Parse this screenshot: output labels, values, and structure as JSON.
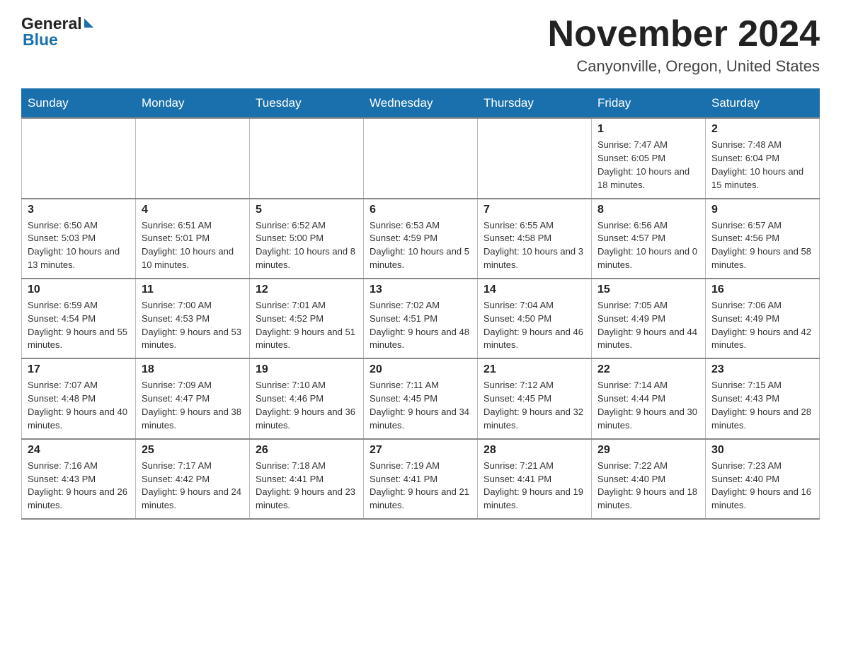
{
  "header": {
    "logo_general": "General",
    "logo_blue": "Blue",
    "month_title": "November 2024",
    "location": "Canyonville, Oregon, United States"
  },
  "calendar": {
    "days_of_week": [
      "Sunday",
      "Monday",
      "Tuesday",
      "Wednesday",
      "Thursday",
      "Friday",
      "Saturday"
    ],
    "weeks": [
      [
        {
          "day": "",
          "info": ""
        },
        {
          "day": "",
          "info": ""
        },
        {
          "day": "",
          "info": ""
        },
        {
          "day": "",
          "info": ""
        },
        {
          "day": "",
          "info": ""
        },
        {
          "day": "1",
          "info": "Sunrise: 7:47 AM\nSunset: 6:05 PM\nDaylight: 10 hours and 18 minutes."
        },
        {
          "day": "2",
          "info": "Sunrise: 7:48 AM\nSunset: 6:04 PM\nDaylight: 10 hours and 15 minutes."
        }
      ],
      [
        {
          "day": "3",
          "info": "Sunrise: 6:50 AM\nSunset: 5:03 PM\nDaylight: 10 hours and 13 minutes."
        },
        {
          "day": "4",
          "info": "Sunrise: 6:51 AM\nSunset: 5:01 PM\nDaylight: 10 hours and 10 minutes."
        },
        {
          "day": "5",
          "info": "Sunrise: 6:52 AM\nSunset: 5:00 PM\nDaylight: 10 hours and 8 minutes."
        },
        {
          "day": "6",
          "info": "Sunrise: 6:53 AM\nSunset: 4:59 PM\nDaylight: 10 hours and 5 minutes."
        },
        {
          "day": "7",
          "info": "Sunrise: 6:55 AM\nSunset: 4:58 PM\nDaylight: 10 hours and 3 minutes."
        },
        {
          "day": "8",
          "info": "Sunrise: 6:56 AM\nSunset: 4:57 PM\nDaylight: 10 hours and 0 minutes."
        },
        {
          "day": "9",
          "info": "Sunrise: 6:57 AM\nSunset: 4:56 PM\nDaylight: 9 hours and 58 minutes."
        }
      ],
      [
        {
          "day": "10",
          "info": "Sunrise: 6:59 AM\nSunset: 4:54 PM\nDaylight: 9 hours and 55 minutes."
        },
        {
          "day": "11",
          "info": "Sunrise: 7:00 AM\nSunset: 4:53 PM\nDaylight: 9 hours and 53 minutes."
        },
        {
          "day": "12",
          "info": "Sunrise: 7:01 AM\nSunset: 4:52 PM\nDaylight: 9 hours and 51 minutes."
        },
        {
          "day": "13",
          "info": "Sunrise: 7:02 AM\nSunset: 4:51 PM\nDaylight: 9 hours and 48 minutes."
        },
        {
          "day": "14",
          "info": "Sunrise: 7:04 AM\nSunset: 4:50 PM\nDaylight: 9 hours and 46 minutes."
        },
        {
          "day": "15",
          "info": "Sunrise: 7:05 AM\nSunset: 4:49 PM\nDaylight: 9 hours and 44 minutes."
        },
        {
          "day": "16",
          "info": "Sunrise: 7:06 AM\nSunset: 4:49 PM\nDaylight: 9 hours and 42 minutes."
        }
      ],
      [
        {
          "day": "17",
          "info": "Sunrise: 7:07 AM\nSunset: 4:48 PM\nDaylight: 9 hours and 40 minutes."
        },
        {
          "day": "18",
          "info": "Sunrise: 7:09 AM\nSunset: 4:47 PM\nDaylight: 9 hours and 38 minutes."
        },
        {
          "day": "19",
          "info": "Sunrise: 7:10 AM\nSunset: 4:46 PM\nDaylight: 9 hours and 36 minutes."
        },
        {
          "day": "20",
          "info": "Sunrise: 7:11 AM\nSunset: 4:45 PM\nDaylight: 9 hours and 34 minutes."
        },
        {
          "day": "21",
          "info": "Sunrise: 7:12 AM\nSunset: 4:45 PM\nDaylight: 9 hours and 32 minutes."
        },
        {
          "day": "22",
          "info": "Sunrise: 7:14 AM\nSunset: 4:44 PM\nDaylight: 9 hours and 30 minutes."
        },
        {
          "day": "23",
          "info": "Sunrise: 7:15 AM\nSunset: 4:43 PM\nDaylight: 9 hours and 28 minutes."
        }
      ],
      [
        {
          "day": "24",
          "info": "Sunrise: 7:16 AM\nSunset: 4:43 PM\nDaylight: 9 hours and 26 minutes."
        },
        {
          "day": "25",
          "info": "Sunrise: 7:17 AM\nSunset: 4:42 PM\nDaylight: 9 hours and 24 minutes."
        },
        {
          "day": "26",
          "info": "Sunrise: 7:18 AM\nSunset: 4:41 PM\nDaylight: 9 hours and 23 minutes."
        },
        {
          "day": "27",
          "info": "Sunrise: 7:19 AM\nSunset: 4:41 PM\nDaylight: 9 hours and 21 minutes."
        },
        {
          "day": "28",
          "info": "Sunrise: 7:21 AM\nSunset: 4:41 PM\nDaylight: 9 hours and 19 minutes."
        },
        {
          "day": "29",
          "info": "Sunrise: 7:22 AM\nSunset: 4:40 PM\nDaylight: 9 hours and 18 minutes."
        },
        {
          "day": "30",
          "info": "Sunrise: 7:23 AM\nSunset: 4:40 PM\nDaylight: 9 hours and 16 minutes."
        }
      ]
    ]
  }
}
